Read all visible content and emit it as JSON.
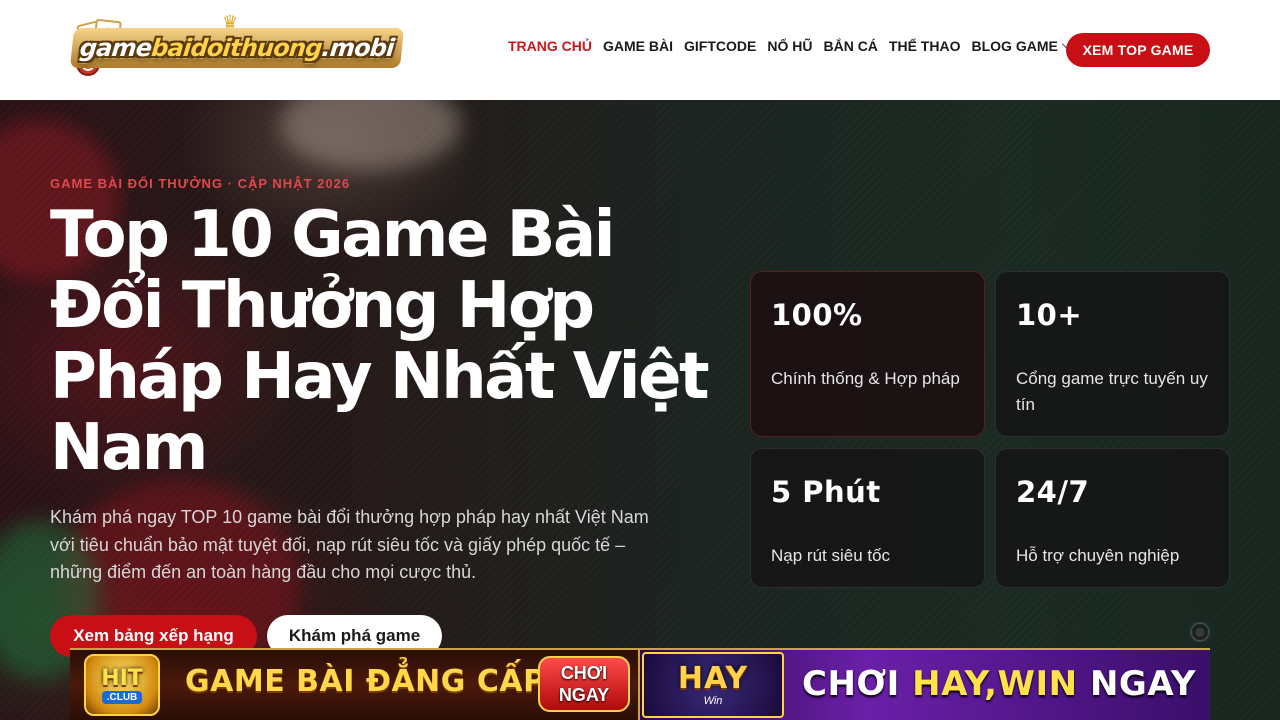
{
  "header": {
    "logo_text_part1": "game",
    "logo_text_part2": "baidoithuong",
    "logo_text_part3": ".mobi",
    "nav": [
      {
        "label": "TRANG CHỦ",
        "active": true
      },
      {
        "label": "GAME BÀI"
      },
      {
        "label": "GIFTCODE"
      },
      {
        "label": "NỔ HŨ"
      },
      {
        "label": "BẮN CÁ"
      },
      {
        "label": "THỂ THAO"
      },
      {
        "label": "BLOG GAME",
        "has_dropdown": true
      }
    ],
    "cta_label": "XEM TOP GAME"
  },
  "hero": {
    "eyebrow": "GAME BÀI ĐỔI THƯỞNG · CẬP NHẬT 2026",
    "title": "Top 10 Game Bài Đổi Thưởng Hợp Pháp Hay Nhất Việt Nam",
    "description": "Khám phá ngay TOP 10 game bài đổi thưởng hợp pháp hay nhất Việt Nam với tiêu chuẩn bảo mật tuyệt đối, nạp rút siêu tốc và giấy phép quốc tế – những điểm đến an toàn hàng đầu cho mọi cược thủ.",
    "primary_button": "Xem bảng xếp hạng",
    "secondary_button": "Khám phá game"
  },
  "stats": [
    {
      "value": "100%",
      "label": "Chính thống & Hợp pháp"
    },
    {
      "value": "10+",
      "label": "Cổng game trực tuyến uy tín"
    },
    {
      "value": "5 Phút",
      "label": "Nạp rút siêu tốc"
    },
    {
      "value": "24/7",
      "label": "Hỗ trợ chuyên nghiệp"
    }
  ],
  "banner": {
    "left_logo_main": "HIT",
    "left_logo_sub": ".CLUB",
    "left_text": "GAME BÀI ĐẲNG CẤP",
    "left_button_line1": "CHƠI",
    "left_button_line2": "NGAY",
    "right_logo_main": "HAY",
    "right_logo_sub": "Win",
    "right_text_part1": "CHƠI ",
    "right_text_part2": "HAY,WIN",
    "right_text_part3": " NGAY",
    "close_symbol": "⊗"
  },
  "colors": {
    "accent": "#c80f16",
    "eyebrow": "#e0484e",
    "active_nav": "#d0141b"
  }
}
